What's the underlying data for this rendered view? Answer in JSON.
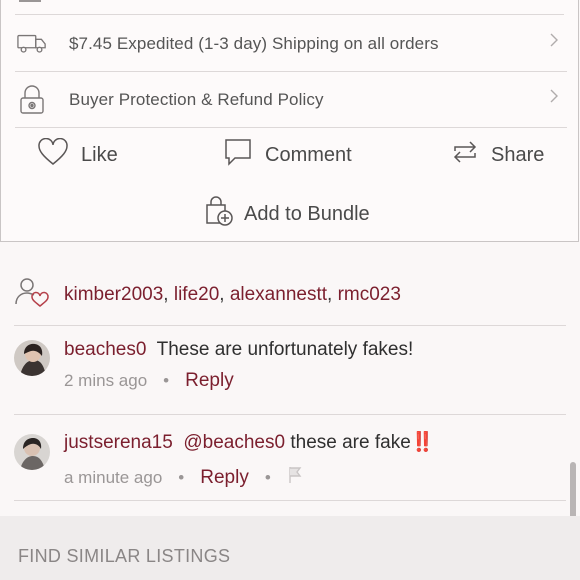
{
  "shipping": {
    "text": "$7.45 Expedited (1-3 day) Shipping on all orders",
    "icon": "truck-icon"
  },
  "protection": {
    "text": "Buyer Protection & Refund Policy",
    "icon": "lock-icon"
  },
  "actions": {
    "like": "Like",
    "comment": "Comment",
    "share": "Share",
    "bundle": "Add to Bundle"
  },
  "likes": {
    "icon": "people-heart-icon",
    "users": [
      "kimber2003",
      "life20",
      "alexannestt",
      "rmc023"
    ],
    "separator": ", "
  },
  "comments": [
    {
      "username": "beaches0",
      "text": "These are unfortunately fakes!",
      "time": "2 mins ago",
      "reply": "Reply"
    },
    {
      "username": "justserena15",
      "mention": "@beaches0",
      "text": "these are fake",
      "emoji": "‼️",
      "time": "a minute ago",
      "reply": "Reply"
    }
  ],
  "similar": {
    "title": "FIND SIMILAR LISTINGS"
  },
  "colors": {
    "link": "#7b1f2e",
    "heart": "#b5404a",
    "muted": "#9a9696"
  }
}
